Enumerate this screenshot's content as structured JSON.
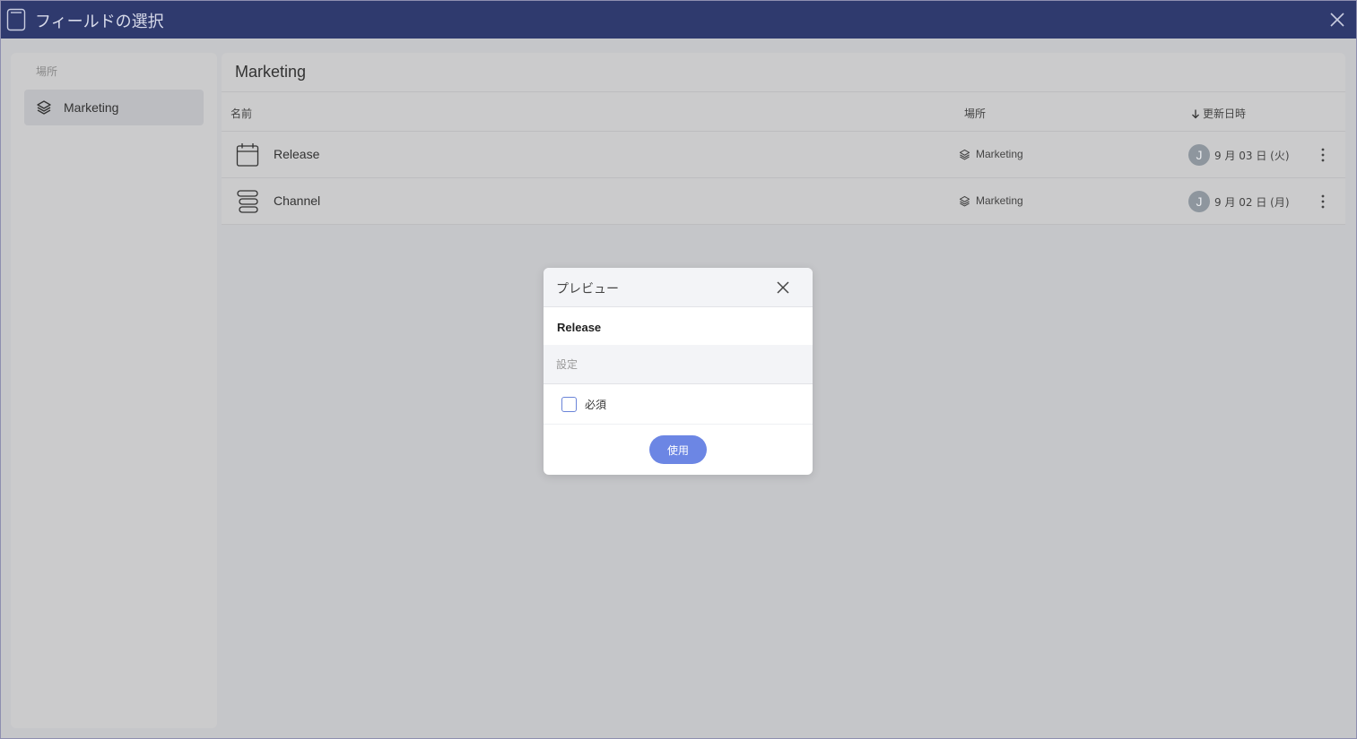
{
  "window": {
    "title": "フィールドの選択",
    "icon": "app-document-icon"
  },
  "sidebar": {
    "section_label": "場所",
    "items": [
      {
        "label": "Marketing",
        "icon": "layers-icon",
        "selected": true
      }
    ]
  },
  "main": {
    "title": "Marketing",
    "columns": {
      "name": "名前",
      "location": "場所",
      "updated": "更新日時",
      "sort_icon": "arrow-down-icon"
    },
    "rows": [
      {
        "icon": "calendar-icon",
        "name": "Release",
        "location": "Marketing",
        "avatar": "J",
        "date": "9 月 03 日 (火)"
      },
      {
        "icon": "list-stack-icon",
        "name": "Channel",
        "location": "Marketing",
        "avatar": "J",
        "date": "9 月 02 日 (月)"
      }
    ]
  },
  "dialog": {
    "title": "プレビュー",
    "field_name": "Release",
    "section": "設定",
    "required_label": "必須",
    "required_checked": false,
    "use_button": "使用"
  },
  "colors": {
    "titlebar": "#2f3a6e",
    "accent": "#6c86e4",
    "avatar": "#8e969e"
  }
}
